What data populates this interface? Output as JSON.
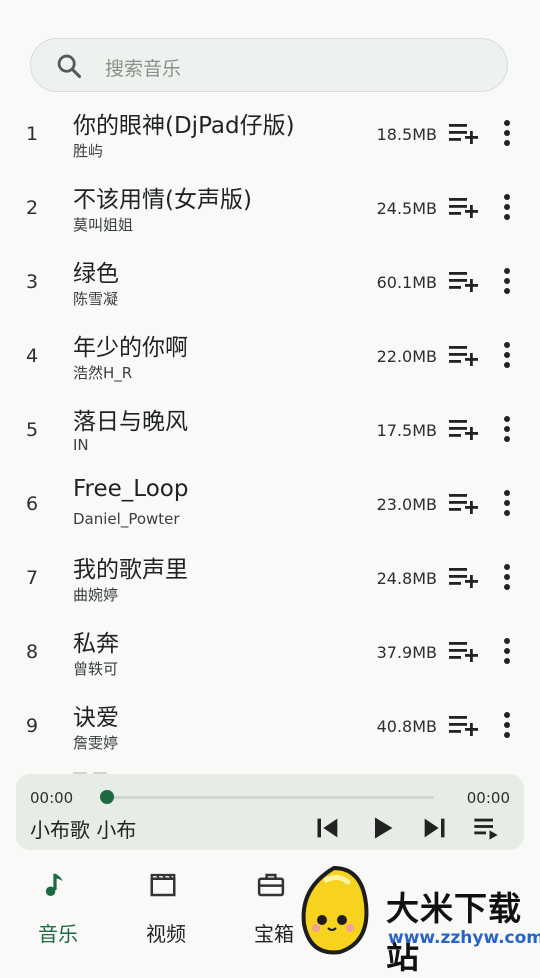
{
  "search": {
    "placeholder": "搜索音乐",
    "icon": "search-icon"
  },
  "songs": [
    {
      "num": "1",
      "title": "你的眼神(DjPad仔版)",
      "artist": "胜屿",
      "size": "18.5MB"
    },
    {
      "num": "2",
      "title": "不该用情(女声版)",
      "artist": "莫叫姐姐",
      "size": "24.5MB"
    },
    {
      "num": "3",
      "title": "绿色",
      "artist": "陈雪凝",
      "size": "60.1MB"
    },
    {
      "num": "4",
      "title": "年少的你啊",
      "artist": "浩然H_R",
      "size": "22.0MB"
    },
    {
      "num": "5",
      "title": "落日与晚风",
      "artist": "IN",
      "size": "17.5MB"
    },
    {
      "num": "6",
      "title": "Free_Loop",
      "artist": "Daniel_Powter",
      "size": "23.0MB"
    },
    {
      "num": "7",
      "title": "我的歌声里",
      "artist": "曲婉婷",
      "size": "24.8MB"
    },
    {
      "num": "8",
      "title": "私奔",
      "artist": "曾轶可",
      "size": "37.9MB"
    },
    {
      "num": "9",
      "title": "诀爱",
      "artist": "詹雯婷",
      "size": "40.8MB"
    }
  ],
  "player": {
    "current_time": "00:00",
    "total_time": "00:00",
    "progress": 0,
    "now_playing": "小布歌 小布"
  },
  "nav": [
    {
      "label": "音乐",
      "icon": "music-note-icon",
      "active": true
    },
    {
      "label": "视频",
      "icon": "film-icon",
      "active": false
    },
    {
      "label": "宝箱",
      "icon": "toolbox-icon",
      "active": false
    }
  ],
  "watermark": {
    "text": "大米下载站",
    "url": "www.zzhyw.com"
  },
  "colors": {
    "accent": "#1c6b40",
    "background": "#f9faf8",
    "player_bg": "#e7ece7"
  }
}
